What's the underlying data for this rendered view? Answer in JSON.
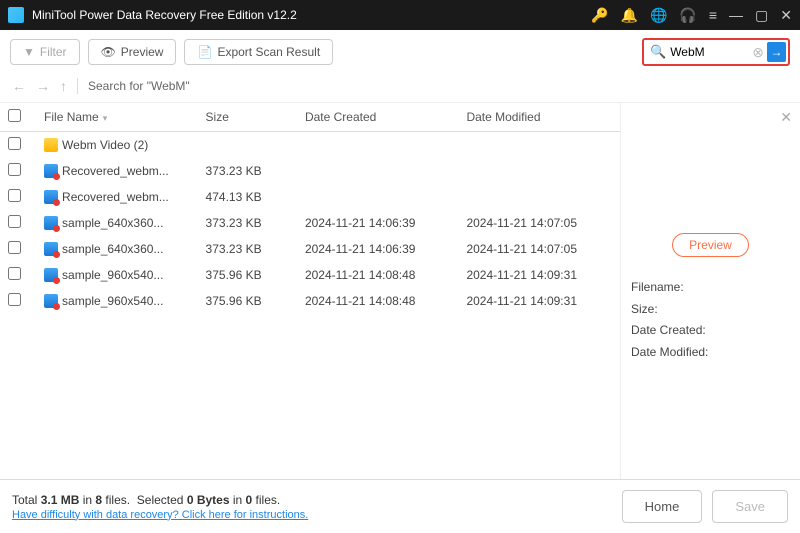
{
  "titlebar": {
    "title": "MiniTool Power Data Recovery Free Edition v12.2"
  },
  "toolbar": {
    "filter": "Filter",
    "preview": "Preview",
    "export": "Export Scan Result"
  },
  "search": {
    "value": "WebM"
  },
  "nav": {
    "crumb": "Search for  \"WebM\""
  },
  "columns": {
    "name": "File Name",
    "size": "Size",
    "created": "Date Created",
    "modified": "Date Modified"
  },
  "rows": [
    {
      "icon": "folder",
      "name": "Webm Video (2)",
      "size": "",
      "created": "",
      "modified": ""
    },
    {
      "icon": "video",
      "name": "Recovered_webm...",
      "size": "373.23 KB",
      "created": "",
      "modified": ""
    },
    {
      "icon": "video",
      "name": "Recovered_webm...",
      "size": "474.13 KB",
      "created": "",
      "modified": ""
    },
    {
      "icon": "video",
      "name": "sample_640x360...",
      "size": "373.23 KB",
      "created": "2024-11-21 14:06:39",
      "modified": "2024-11-21 14:07:05"
    },
    {
      "icon": "video",
      "name": "sample_640x360...",
      "size": "373.23 KB",
      "created": "2024-11-21 14:06:39",
      "modified": "2024-11-21 14:07:05"
    },
    {
      "icon": "video",
      "name": "sample_960x540...",
      "size": "375.96 KB",
      "created": "2024-11-21 14:08:48",
      "modified": "2024-11-21 14:09:31"
    },
    {
      "icon": "video",
      "name": "sample_960x540...",
      "size": "375.96 KB",
      "created": "2024-11-21 14:08:48",
      "modified": "2024-11-21 14:09:31"
    }
  ],
  "preview": {
    "button": "Preview",
    "filename": "Filename:",
    "size": "Size:",
    "created": "Date Created:",
    "modified": "Date Modified:"
  },
  "footer": {
    "total_prefix": "Total ",
    "total_size": "3.1 MB",
    "total_mid": " in ",
    "total_files": "8",
    "total_suffix": " files.",
    "sel_prefix": "Selected ",
    "sel_size": "0 Bytes",
    "sel_mid": " in ",
    "sel_files": "0",
    "sel_suffix": " files.",
    "help": "Have difficulty with data recovery? Click here for instructions.",
    "home": "Home",
    "save": "Save"
  }
}
